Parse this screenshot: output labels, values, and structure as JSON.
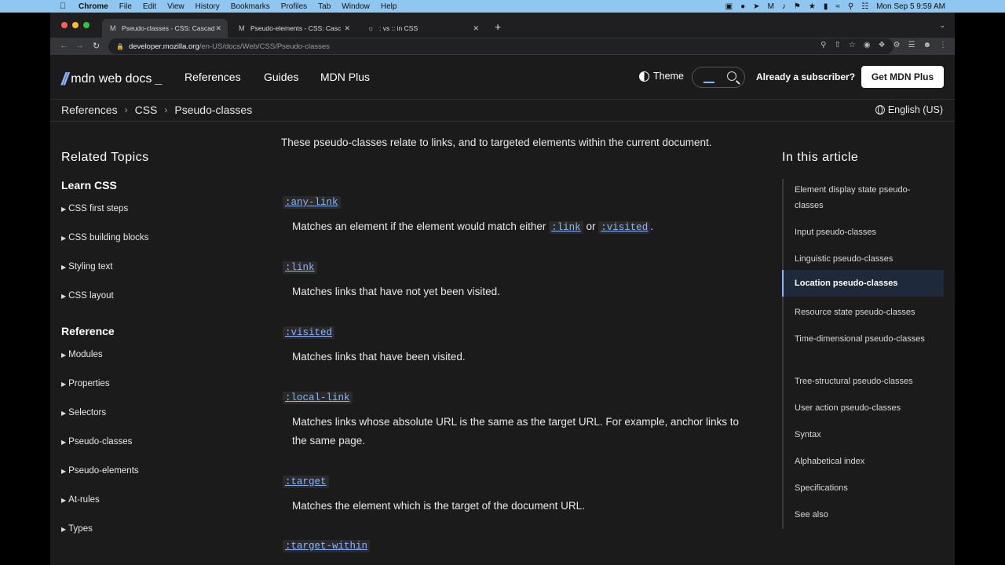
{
  "menubar": {
    "app": "Chrome",
    "items": [
      "File",
      "Edit",
      "View",
      "History",
      "Bookmarks",
      "Profiles",
      "Tab",
      "Window",
      "Help"
    ],
    "datetime": "Mon Sep 5  9:59 AM"
  },
  "tabs": [
    {
      "title": "Pseudo-classes - CSS: Cascad",
      "favicon": "mdn-icon"
    },
    {
      "title": "Pseudo-elements - CSS: Casc",
      "favicon": "mdn-icon"
    },
    {
      "title": ": vs :: in CSS",
      "favicon": "globe-icon"
    }
  ],
  "url": {
    "host": "developer.mozilla.org",
    "path": "/en-US/docs/Web/CSS/Pseudo-classes"
  },
  "mdn": {
    "logo_text": "mdn web docs",
    "nav": [
      "References",
      "Guides",
      "MDN Plus"
    ],
    "theme_label": "Theme",
    "subscriber_label": "Already a subscriber?",
    "get_plus_label": "Get MDN Plus",
    "breadcrumbs": [
      "References",
      "CSS",
      "Pseudo-classes"
    ],
    "language": "English (US)"
  },
  "sidebar": {
    "title": "Related Topics",
    "sections": [
      {
        "title": "Learn CSS",
        "items": [
          "CSS first steps",
          "CSS building blocks",
          "Styling text",
          "CSS layout"
        ]
      },
      {
        "title": "Reference",
        "items": [
          "Modules",
          "Properties",
          "Selectors",
          "Pseudo-classes",
          "Pseudo-elements",
          "At-rules",
          "Types"
        ]
      }
    ]
  },
  "content": {
    "intro": "These pseudo-classes relate to links, and to targeted elements within the current document.",
    "entries": [
      {
        "term": ":any-link",
        "desc_before": "Matches an element if the element would match either ",
        "code1": ":link",
        "mid": " or ",
        "code2": ":visited",
        "after": "."
      },
      {
        "term": ":link",
        "desc": "Matches links that have not yet been visited."
      },
      {
        "term": ":visited",
        "desc": "Matches links that have been visited."
      },
      {
        "term": ":local-link",
        "desc": "Matches links whose absolute URL is the same as the target URL. For example, anchor links to the same page."
      },
      {
        "term": ":target",
        "desc": "Matches the element which is the target of the document URL."
      },
      {
        "term": ":target-within"
      }
    ]
  },
  "toc": {
    "title": "In this article",
    "items": [
      "Element display state pseudo-classes",
      "Input pseudo-classes",
      "Linguistic pseudo-classes",
      "Location pseudo-classes",
      "Resource state pseudo-classes",
      "Time-dimensional pseudo-classes",
      "Tree-structural pseudo-classes",
      "User action pseudo-classes",
      "Syntax",
      "Alphabetical index",
      "Specifications",
      "See also"
    ],
    "active_index": 3
  }
}
